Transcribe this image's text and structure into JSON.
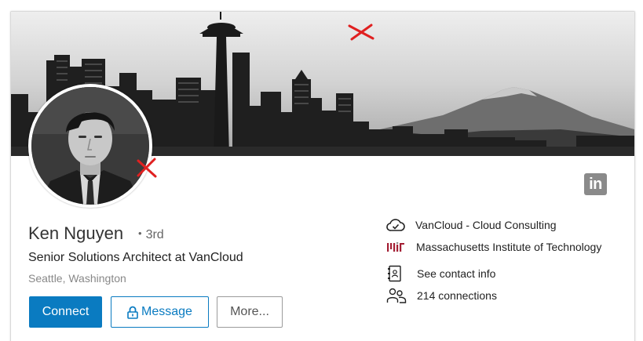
{
  "profile": {
    "name": "Ken Nguyen",
    "degree": "3rd",
    "headline": "Senior Solutions Architect at VanCloud",
    "location": "Seattle, Washington"
  },
  "actions": {
    "connect_label": "Connect",
    "message_label": "Message",
    "more_label": "More..."
  },
  "info": {
    "company": "VanCloud - Cloud Consulting",
    "school": "Massachusetts Institute of Technology",
    "contact": "See contact info",
    "connections": "214 connections"
  },
  "icons": {
    "network_brand": "linkedin-icon",
    "company": "cloud-check-icon",
    "school": "mit-logo-icon",
    "contact": "contact-card-icon",
    "connections": "people-icon",
    "message": "lock-icon",
    "annotation": "red-x-mark"
  },
  "colors": {
    "primary": "#0a7bc1",
    "annotation": "#e02020",
    "school_logo": "#a31f34",
    "brand_icon": "#8a8a8a"
  }
}
